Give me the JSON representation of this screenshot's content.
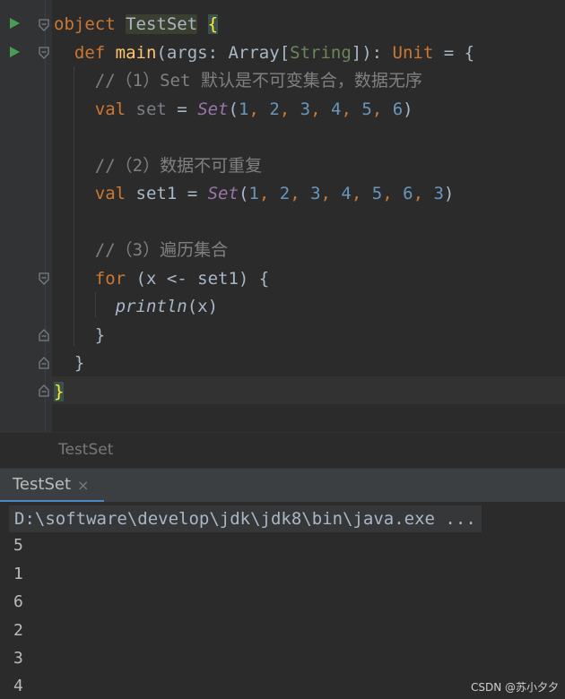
{
  "editor": {
    "lines": [
      {
        "parts": [
          {
            "c": "kw",
            "t": "object "
          },
          {
            "c": "hl-name",
            "t": "TestSet"
          },
          {
            "c": "ty",
            "t": " "
          },
          {
            "c": "brace-hl",
            "t": "{"
          }
        ]
      },
      {
        "parts": [
          {
            "c": "ty",
            "t": "  "
          },
          {
            "c": "kw",
            "t": "def "
          },
          {
            "c": "fn",
            "t": "main"
          },
          {
            "c": "ty",
            "t": "(args: Array["
          },
          {
            "c": "tyg",
            "t": "String"
          },
          {
            "c": "ty",
            "t": "]): "
          },
          {
            "c": "kw",
            "t": "Unit"
          },
          {
            "c": "ty",
            "t": " = {"
          }
        ]
      },
      {
        "parts": [
          {
            "c": "ty",
            "t": "    "
          },
          {
            "c": "cm",
            "t": "//（1）Set 默认是不可变集合，数据无序"
          }
        ]
      },
      {
        "parts": [
          {
            "c": "ty",
            "t": "    "
          },
          {
            "c": "kw",
            "t": "val "
          },
          {
            "c": "dim",
            "t": "set"
          },
          {
            "c": "ty",
            "t": " = "
          },
          {
            "c": "it",
            "t": "Set"
          },
          {
            "c": "ty",
            "t": "("
          },
          {
            "c": "num",
            "t": "1"
          },
          {
            "c": "kw",
            "t": ", "
          },
          {
            "c": "num",
            "t": "2"
          },
          {
            "c": "kw",
            "t": ", "
          },
          {
            "c": "num",
            "t": "3"
          },
          {
            "c": "kw",
            "t": ", "
          },
          {
            "c": "num",
            "t": "4"
          },
          {
            "c": "kw",
            "t": ", "
          },
          {
            "c": "num",
            "t": "5"
          },
          {
            "c": "kw",
            "t": ", "
          },
          {
            "c": "num",
            "t": "6"
          },
          {
            "c": "ty",
            "t": ")"
          }
        ]
      },
      {
        "parts": []
      },
      {
        "parts": [
          {
            "c": "ty",
            "t": "    "
          },
          {
            "c": "cm",
            "t": "//（2）数据不可重复"
          }
        ]
      },
      {
        "parts": [
          {
            "c": "ty",
            "t": "    "
          },
          {
            "c": "kw",
            "t": "val "
          },
          {
            "c": "ty",
            "t": "set1 = "
          },
          {
            "c": "it",
            "t": "Set"
          },
          {
            "c": "ty",
            "t": "("
          },
          {
            "c": "num",
            "t": "1"
          },
          {
            "c": "kw",
            "t": ", "
          },
          {
            "c": "num",
            "t": "2"
          },
          {
            "c": "kw",
            "t": ", "
          },
          {
            "c": "num",
            "t": "3"
          },
          {
            "c": "kw",
            "t": ", "
          },
          {
            "c": "num",
            "t": "4"
          },
          {
            "c": "kw",
            "t": ", "
          },
          {
            "c": "num",
            "t": "5"
          },
          {
            "c": "kw",
            "t": ", "
          },
          {
            "c": "num",
            "t": "6"
          },
          {
            "c": "kw",
            "t": ", "
          },
          {
            "c": "num",
            "t": "3"
          },
          {
            "c": "ty",
            "t": ")"
          }
        ]
      },
      {
        "parts": []
      },
      {
        "parts": [
          {
            "c": "ty",
            "t": "    "
          },
          {
            "c": "cm",
            "t": "//（3）遍历集合"
          }
        ]
      },
      {
        "parts": [
          {
            "c": "ty",
            "t": "    "
          },
          {
            "c": "kw",
            "t": "for "
          },
          {
            "c": "ty",
            "t": "(x <- set1) {"
          }
        ]
      },
      {
        "parts": [
          {
            "c": "ty",
            "t": "      "
          },
          {
            "c": "itw",
            "t": "println"
          },
          {
            "c": "ty",
            "t": "(x)"
          }
        ]
      },
      {
        "parts": [
          {
            "c": "ty",
            "t": "    }"
          }
        ]
      },
      {
        "parts": [
          {
            "c": "ty",
            "t": "  }"
          }
        ]
      },
      {
        "parts": [
          {
            "c": "brace-hl",
            "t": "}"
          }
        ]
      }
    ]
  },
  "breadcrumb": {
    "label": "TestSet"
  },
  "run_panel": {
    "tab_label": "TestSet",
    "tab_close": "×",
    "command": "D:\\software\\develop\\jdk\\jdk8\\bin\\java.exe ...",
    "output": [
      "5",
      "1",
      "6",
      "2",
      "3",
      "4"
    ]
  },
  "watermark": "CSDN @苏小夕夕",
  "colors": {
    "keyword": "#cc7832",
    "number": "#6897bb",
    "comment": "#808080",
    "function": "#ffc66d",
    "italic_call": "#9876aa",
    "run_icon": "#499c54",
    "tab_underline": "#4a88c7"
  }
}
